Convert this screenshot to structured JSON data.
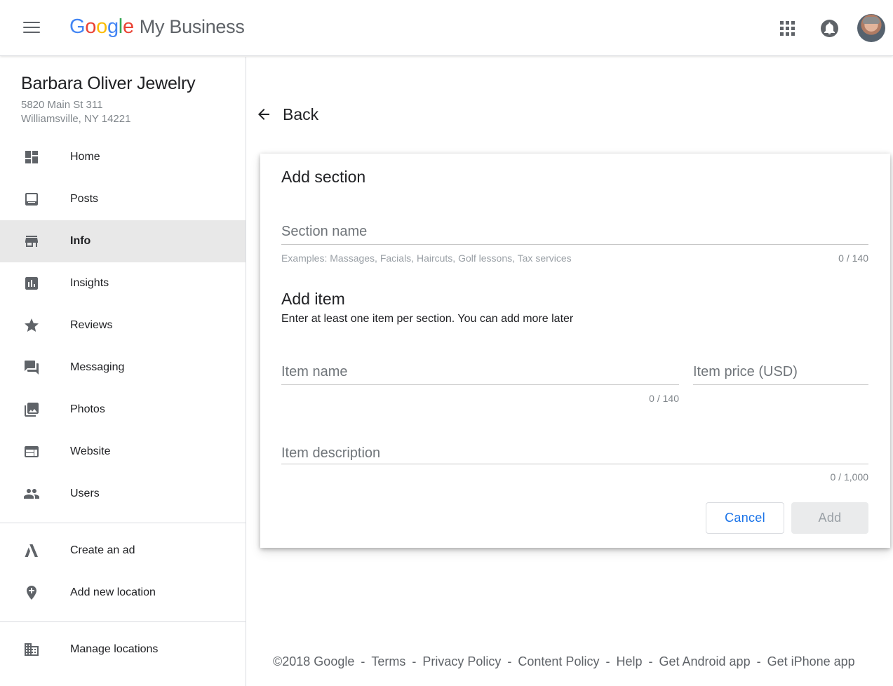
{
  "header": {
    "logo_letters": [
      {
        "ch": "G",
        "color": "#4285F4"
      },
      {
        "ch": "o",
        "color": "#EA4335"
      },
      {
        "ch": "o",
        "color": "#FBBC05"
      },
      {
        "ch": "g",
        "color": "#4285F4"
      },
      {
        "ch": "l",
        "color": "#34A853"
      },
      {
        "ch": "e",
        "color": "#EA4335"
      }
    ],
    "product_name": "My Business",
    "icons": [
      "menu-icon",
      "apps-icon",
      "notifications-icon",
      "avatar"
    ]
  },
  "sidebar": {
    "business_name": "Barbara Oliver Jewelry",
    "address_line1": "5820 Main St 311",
    "address_line2": "Williamsville, NY 14221",
    "items": [
      {
        "label": "Home",
        "icon": "dashboard-icon"
      },
      {
        "label": "Posts",
        "icon": "posts-icon"
      },
      {
        "label": "Info",
        "icon": "storefront-icon",
        "active": true
      },
      {
        "label": "Insights",
        "icon": "insights-icon"
      },
      {
        "label": "Reviews",
        "icon": "star-icon"
      },
      {
        "label": "Messaging",
        "icon": "messaging-icon"
      },
      {
        "label": "Photos",
        "icon": "photos-icon"
      },
      {
        "label": "Website",
        "icon": "website-icon"
      },
      {
        "label": "Users",
        "icon": "users-icon"
      }
    ],
    "secondary_items": [
      {
        "label": "Create an ad",
        "icon": "ads-icon"
      },
      {
        "label": "Add new location",
        "icon": "add-location-icon"
      }
    ],
    "tertiary_items": [
      {
        "label": "Manage locations",
        "icon": "building-icon"
      }
    ]
  },
  "main": {
    "back_label": "Back",
    "card": {
      "title": "Add section",
      "section_name_placeholder": "Section name",
      "section_hint": "Examples: Massages, Facials, Haircuts, Golf lessons, Tax services",
      "section_counter": "0 / 140",
      "add_item_title": "Add item",
      "add_item_desc": "Enter at least one item per section. You can add more later",
      "item_name_placeholder": "Item name",
      "item_name_counter": "0 / 140",
      "item_price_placeholder": "Item price (USD)",
      "item_desc_placeholder": "Item description",
      "item_desc_counter": "0 / 1,000",
      "cancel_label": "Cancel",
      "add_label": "Add"
    }
  },
  "footer": {
    "copyright": "©2018 Google",
    "links": [
      "Terms",
      "Privacy Policy",
      "Content Policy",
      "Help",
      "Get Android app",
      "Get iPhone app"
    ],
    "separator": "-"
  },
  "colors": {
    "accent": "#1a73e8",
    "active_nav_bg": "#e8e8e8",
    "icon_gray": "#5f6368"
  }
}
